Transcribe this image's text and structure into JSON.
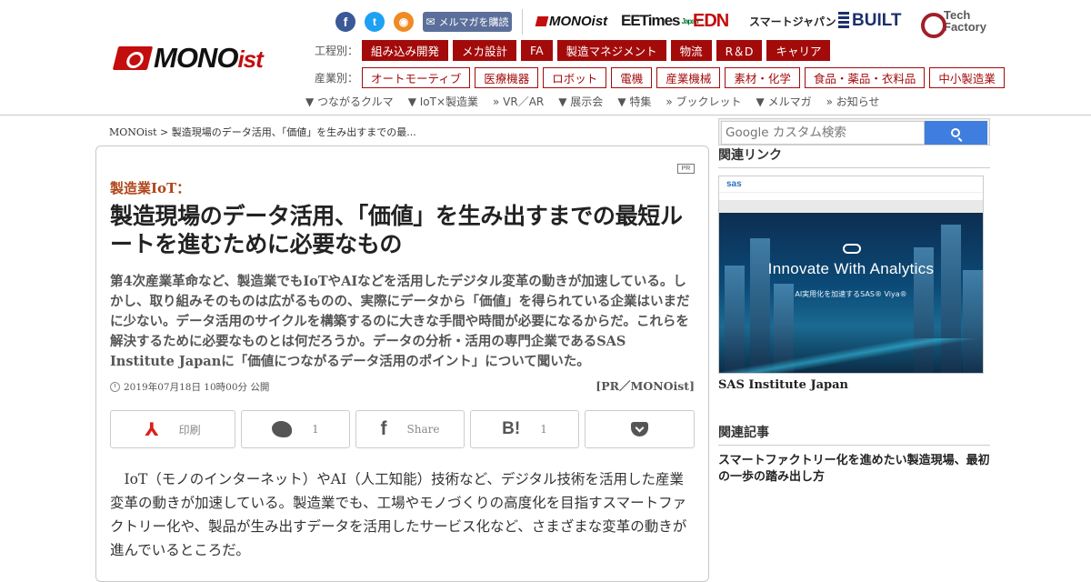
{
  "header": {
    "logo_text": "MONO",
    "logo_suffix": "ist",
    "mailmag_label": "メルマガを購読",
    "brands": {
      "monoist": "MONOist",
      "eetimes": "EETimes",
      "eetimes_sub": "Japan",
      "edn": "EDN",
      "smartjapan": "スマートジャパン",
      "built": "BUILT",
      "techfactory_1": "Tech",
      "techfactory_2": "Factory"
    },
    "process_label": "工程別：",
    "process_tags": [
      "組み込み開発",
      "メカ設計",
      "FA",
      "製造マネジメント",
      "物流",
      "R＆D",
      "キャリア"
    ],
    "industry_label": "産業別：",
    "industry_tags": [
      "オートモーティブ",
      "医療機器",
      "ロボット",
      "電機",
      "産業機械",
      "素材・化学",
      "食品・薬品・衣料品",
      "中小製造業"
    ],
    "subnav": [
      "▼ つながるクルマ",
      "▼ IoT×製造業",
      "» VR／AR",
      "▼ 展示会",
      "▼ 特集",
      "» ブックレット",
      "▼ メルマガ",
      "» お知らせ"
    ]
  },
  "breadcrumb": "MONOist > 製造現場のデータ活用、「価値」を生み出すまでの最...",
  "article": {
    "pr_badge": "PR",
    "kicker": "製造業IoT：",
    "title": "製造現場のデータ活用、「価値」を生み出すまでの最短ルートを進むために必要なもの",
    "lead": "第4次産業革命など、製造業でもIoTやAIなどを活用したデジタル変革の動きが加速している。しかし、取り組みそのものは広がるものの、実際にデータから「価値」を得られている企業はいまだに少ない。データ活用のサイクルを構築するのに大きな手間や時間が必要になるからだ。これらを解決するために必要なものとは何だろうか。データの分析・活用の専門企業であるSAS Institute Japanに「価値につながるデータ活用のポイント」について聞いた。",
    "date": "2019年07月18日 10時00分 公開",
    "credit": "[PR／MONOist]",
    "share": {
      "print_label": "印刷",
      "tweet_count": "1",
      "share_label": "Share",
      "hatena_count": "1"
    },
    "body": "IoT（モノのインターネット）やAI（人工知能）技術など、デジタル技術を活用した産業変革の動きが加速している。製造業でも、工場やモノづくりの高度化を目指すスマートファクトリー化や、製品が生み出すデータを活用したサービス化など、さまざまな変革の動きが進んでいるところだ。"
  },
  "sidebar": {
    "search_placeholder": "Google カスタム検索",
    "links_heading": "関連リンク",
    "ad_brand": "sas",
    "ad_headline": "Innovate With Analytics",
    "ad_sub": "AI実用化を加速するSAS® Viya®",
    "ad_caption": "SAS Institute Japan",
    "articles_heading": "関連記事",
    "related_article": "スマートファクトリー化を進めたい製造現場、最初の一歩の踏み出し方"
  },
  "colors": {
    "accent": "#a30b0b",
    "kicker": "#b0451a",
    "search_button": "#3f7ede"
  }
}
